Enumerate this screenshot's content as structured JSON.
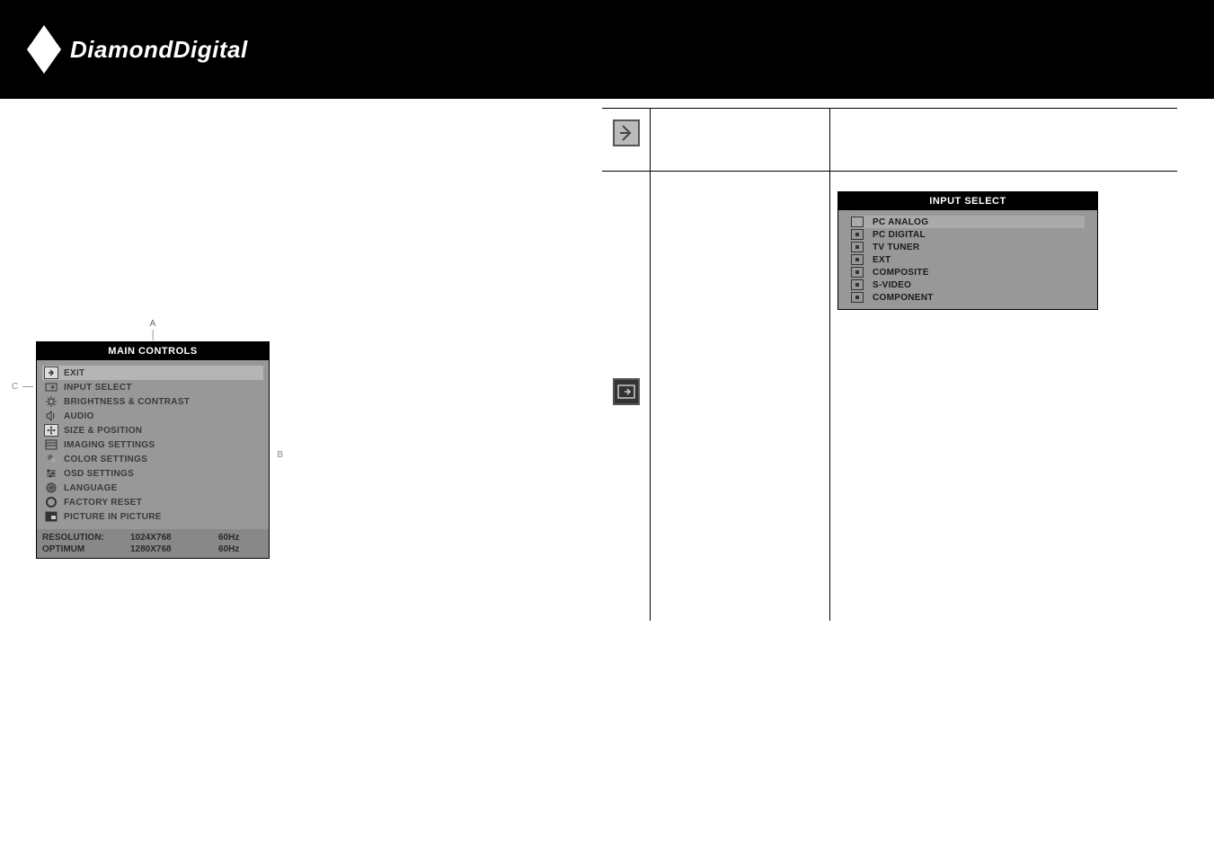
{
  "brand": "DiamondDigital",
  "leftPanel": {
    "title": "MAIN CONTROLS",
    "markerA": "A",
    "markerB": "B",
    "markerC": "C",
    "items": [
      {
        "label": "EXIT",
        "selected": true
      },
      {
        "label": "INPUT SELECT"
      },
      {
        "label": "BRIGHTNESS & CONTRAST"
      },
      {
        "label": "AUDIO"
      },
      {
        "label": "SIZE & POSITION"
      },
      {
        "label": "IMAGING SETTINGS"
      },
      {
        "label": "COLOR SETTINGS"
      },
      {
        "label": "OSD SETTINGS"
      },
      {
        "label": "LANGUAGE"
      },
      {
        "label": "FACTORY RESET"
      },
      {
        "label": "PICTURE IN PICTURE"
      }
    ],
    "footer": {
      "resLabel": "RESOLUTION:",
      "resVal": "1024X768",
      "resHz": "60Hz",
      "optLabel": "OPTIMUM",
      "optVal": "1280X768",
      "optHz": "60Hz"
    }
  },
  "inputSelect": {
    "title": "INPUT SELECT",
    "items": [
      {
        "label": "PC ANALOG",
        "selected": true
      },
      {
        "label": "PC DIGITAL"
      },
      {
        "label": "TV TUNER"
      },
      {
        "label": "EXT"
      },
      {
        "label": "COMPOSITE"
      },
      {
        "label": "S-VIDEO"
      },
      {
        "label": "COMPONENT"
      }
    ]
  }
}
